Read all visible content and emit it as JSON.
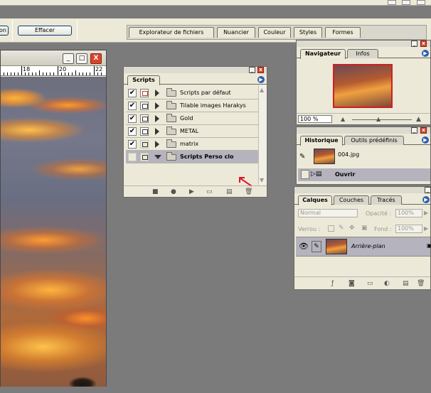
{
  "toolbar": {
    "left_button_label": "on",
    "clear_button_label": "Effacer",
    "well_tabs": [
      "Explorateur de fichiers",
      "Nuancier",
      "Couleur",
      "Styles",
      "Formes"
    ]
  },
  "document": {
    "ruler_labels": [
      "18",
      "20",
      "22"
    ],
    "window_buttons": {
      "minimize": "_",
      "maximize": "□",
      "close": "X"
    }
  },
  "scripts_palette": {
    "tab": "Scripts",
    "items": [
      {
        "label": "Scripts par défaut",
        "checked": true,
        "open": false
      },
      {
        "label": "Tilable images Harakys",
        "checked": true,
        "open": false
      },
      {
        "label": "Gold",
        "checked": true,
        "open": false
      },
      {
        "label": "METAL",
        "checked": true,
        "open": false
      },
      {
        "label": "matrix",
        "checked": true,
        "open": false
      },
      {
        "label": "Scripts Perso clo",
        "checked": false,
        "open": true
      }
    ],
    "check_mark": "✔"
  },
  "navigator_palette": {
    "tabs": [
      "Navigateur",
      "Infos"
    ],
    "zoom": "100 %"
  },
  "history_palette": {
    "tabs": [
      "Historique",
      "Outils prédéfinis"
    ],
    "snapshot": "004.jpg",
    "state": "Ouvrir"
  },
  "layers_palette": {
    "tabs": [
      "Calques",
      "Couches",
      "Tracés"
    ],
    "blend_mode": "Normal",
    "opacity_label": "Opacité :",
    "opacity_value": "100%",
    "lock_label": "Verrou :",
    "fill_label": "Fond :",
    "fill_value": "100%",
    "layer_name": "Arrière-plan"
  },
  "colors": {
    "accent": "#2f5fae",
    "close_button": "#d8452c",
    "highlight_row": "#b4b3be",
    "annotation_arrow": "#e0102a"
  }
}
